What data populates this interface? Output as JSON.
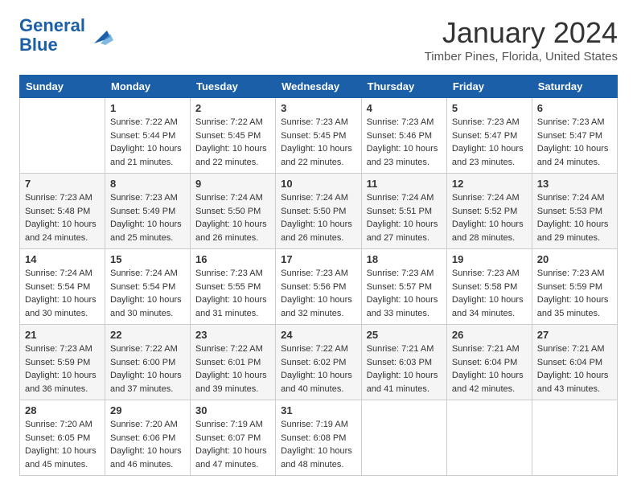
{
  "header": {
    "logo_line1": "General",
    "logo_line2": "Blue",
    "month_title": "January 2024",
    "location": "Timber Pines, Florida, United States"
  },
  "weekdays": [
    "Sunday",
    "Monday",
    "Tuesday",
    "Wednesday",
    "Thursday",
    "Friday",
    "Saturday"
  ],
  "weeks": [
    [
      {
        "day": "",
        "sunrise": "",
        "sunset": "",
        "daylight": ""
      },
      {
        "day": "1",
        "sunrise": "7:22 AM",
        "sunset": "5:44 PM",
        "daylight": "10 hours and 21 minutes."
      },
      {
        "day": "2",
        "sunrise": "7:22 AM",
        "sunset": "5:45 PM",
        "daylight": "10 hours and 22 minutes."
      },
      {
        "day": "3",
        "sunrise": "7:23 AM",
        "sunset": "5:45 PM",
        "daylight": "10 hours and 22 minutes."
      },
      {
        "day": "4",
        "sunrise": "7:23 AM",
        "sunset": "5:46 PM",
        "daylight": "10 hours and 23 minutes."
      },
      {
        "day": "5",
        "sunrise": "7:23 AM",
        "sunset": "5:47 PM",
        "daylight": "10 hours and 23 minutes."
      },
      {
        "day": "6",
        "sunrise": "7:23 AM",
        "sunset": "5:47 PM",
        "daylight": "10 hours and 24 minutes."
      }
    ],
    [
      {
        "day": "7",
        "sunrise": "7:23 AM",
        "sunset": "5:48 PM",
        "daylight": "10 hours and 24 minutes."
      },
      {
        "day": "8",
        "sunrise": "7:23 AM",
        "sunset": "5:49 PM",
        "daylight": "10 hours and 25 minutes."
      },
      {
        "day": "9",
        "sunrise": "7:24 AM",
        "sunset": "5:50 PM",
        "daylight": "10 hours and 26 minutes."
      },
      {
        "day": "10",
        "sunrise": "7:24 AM",
        "sunset": "5:50 PM",
        "daylight": "10 hours and 26 minutes."
      },
      {
        "day": "11",
        "sunrise": "7:24 AM",
        "sunset": "5:51 PM",
        "daylight": "10 hours and 27 minutes."
      },
      {
        "day": "12",
        "sunrise": "7:24 AM",
        "sunset": "5:52 PM",
        "daylight": "10 hours and 28 minutes."
      },
      {
        "day": "13",
        "sunrise": "7:24 AM",
        "sunset": "5:53 PM",
        "daylight": "10 hours and 29 minutes."
      }
    ],
    [
      {
        "day": "14",
        "sunrise": "7:24 AM",
        "sunset": "5:54 PM",
        "daylight": "10 hours and 30 minutes."
      },
      {
        "day": "15",
        "sunrise": "7:24 AM",
        "sunset": "5:54 PM",
        "daylight": "10 hours and 30 minutes."
      },
      {
        "day": "16",
        "sunrise": "7:23 AM",
        "sunset": "5:55 PM",
        "daylight": "10 hours and 31 minutes."
      },
      {
        "day": "17",
        "sunrise": "7:23 AM",
        "sunset": "5:56 PM",
        "daylight": "10 hours and 32 minutes."
      },
      {
        "day": "18",
        "sunrise": "7:23 AM",
        "sunset": "5:57 PM",
        "daylight": "10 hours and 33 minutes."
      },
      {
        "day": "19",
        "sunrise": "7:23 AM",
        "sunset": "5:58 PM",
        "daylight": "10 hours and 34 minutes."
      },
      {
        "day": "20",
        "sunrise": "7:23 AM",
        "sunset": "5:59 PM",
        "daylight": "10 hours and 35 minutes."
      }
    ],
    [
      {
        "day": "21",
        "sunrise": "7:23 AM",
        "sunset": "5:59 PM",
        "daylight": "10 hours and 36 minutes."
      },
      {
        "day": "22",
        "sunrise": "7:22 AM",
        "sunset": "6:00 PM",
        "daylight": "10 hours and 37 minutes."
      },
      {
        "day": "23",
        "sunrise": "7:22 AM",
        "sunset": "6:01 PM",
        "daylight": "10 hours and 39 minutes."
      },
      {
        "day": "24",
        "sunrise": "7:22 AM",
        "sunset": "6:02 PM",
        "daylight": "10 hours and 40 minutes."
      },
      {
        "day": "25",
        "sunrise": "7:21 AM",
        "sunset": "6:03 PM",
        "daylight": "10 hours and 41 minutes."
      },
      {
        "day": "26",
        "sunrise": "7:21 AM",
        "sunset": "6:04 PM",
        "daylight": "10 hours and 42 minutes."
      },
      {
        "day": "27",
        "sunrise": "7:21 AM",
        "sunset": "6:04 PM",
        "daylight": "10 hours and 43 minutes."
      }
    ],
    [
      {
        "day": "28",
        "sunrise": "7:20 AM",
        "sunset": "6:05 PM",
        "daylight": "10 hours and 45 minutes."
      },
      {
        "day": "29",
        "sunrise": "7:20 AM",
        "sunset": "6:06 PM",
        "daylight": "10 hours and 46 minutes."
      },
      {
        "day": "30",
        "sunrise": "7:19 AM",
        "sunset": "6:07 PM",
        "daylight": "10 hours and 47 minutes."
      },
      {
        "day": "31",
        "sunrise": "7:19 AM",
        "sunset": "6:08 PM",
        "daylight": "10 hours and 48 minutes."
      },
      {
        "day": "",
        "sunrise": "",
        "sunset": "",
        "daylight": ""
      },
      {
        "day": "",
        "sunrise": "",
        "sunset": "",
        "daylight": ""
      },
      {
        "day": "",
        "sunrise": "",
        "sunset": "",
        "daylight": ""
      }
    ]
  ]
}
